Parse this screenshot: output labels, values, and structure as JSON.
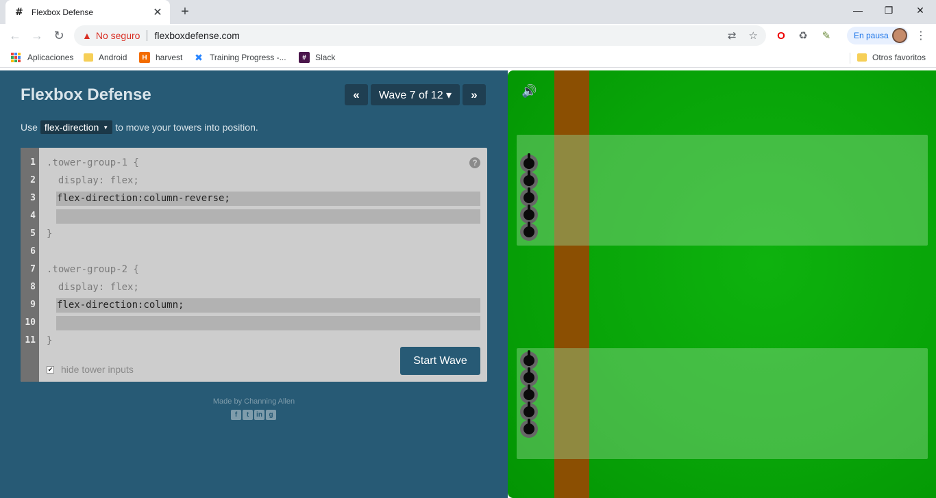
{
  "browser": {
    "tab": {
      "favicon": "#",
      "title": "Flexbox Defense",
      "close": "✕"
    },
    "new_tab": "+",
    "window_controls": {
      "minimize": "—",
      "restore": "❐",
      "close": "✕"
    },
    "nav": {
      "back": "←",
      "forward": "→",
      "reload": "↻"
    },
    "address": {
      "warning_icon": "▲",
      "security_label": "No seguro",
      "url": "flexboxdefense.com"
    },
    "omnibox_icons": {
      "translate": "⇄",
      "bookmark": "☆"
    },
    "profile": {
      "label": "En pausa"
    },
    "menu": "⋮",
    "bookmarks": [
      {
        "label": "Aplicaciones",
        "icon": "apps-grid-icon"
      },
      {
        "label": "Android",
        "icon": "folder-icon"
      },
      {
        "label": "harvest",
        "icon": "harvest-icon",
        "glyph": "H"
      },
      {
        "label": "Training Progress -...",
        "icon": "confluence-icon",
        "glyph": "✖"
      },
      {
        "label": "Slack",
        "icon": "slack-icon",
        "glyph": "#"
      }
    ],
    "other_bookmarks": "Otros favoritos"
  },
  "game": {
    "title": "Flexbox Defense",
    "wave": {
      "prev": "«",
      "label": "Wave 7 of 12 ▾",
      "next": "»"
    },
    "instructions": {
      "prefix": "Use",
      "property": "flex-direction",
      "suffix": "to move your towers into position."
    },
    "line_numbers": [
      "1",
      "2",
      "3",
      "4",
      "5",
      "6",
      "7",
      "8",
      "9",
      "10",
      "11"
    ],
    "code": {
      "line1": ".tower-group-1 {",
      "line2": "  display: flex;",
      "input1a": "flex-direction:column-reverse;",
      "input1b": "",
      "line5": "}",
      "line7": ".tower-group-2 {",
      "line8": "  display: flex;",
      "input2a": "flex-direction:column;",
      "input2b": "",
      "line11": "}"
    },
    "help": "?",
    "hide_inputs_label": "hide tower inputs",
    "hide_inputs_checked": true,
    "start_button": "Start Wave",
    "credit": "Made by Channing Allen",
    "socials": [
      {
        "name": "facebook-icon",
        "glyph": "f"
      },
      {
        "name": "twitter-icon",
        "glyph": "t"
      },
      {
        "name": "linkedin-icon",
        "glyph": "in"
      },
      {
        "name": "github-icon",
        "glyph": "g"
      }
    ],
    "sound_icon": "🔊",
    "tower_groups": [
      {
        "name": "tower-group-1",
        "towers": 5
      },
      {
        "name": "tower-group-2",
        "towers": 5
      }
    ],
    "colors": {
      "panel": "#275a75",
      "field": "#08a408",
      "path": "#8b4f02",
      "editor": "#cdcdcd"
    }
  }
}
